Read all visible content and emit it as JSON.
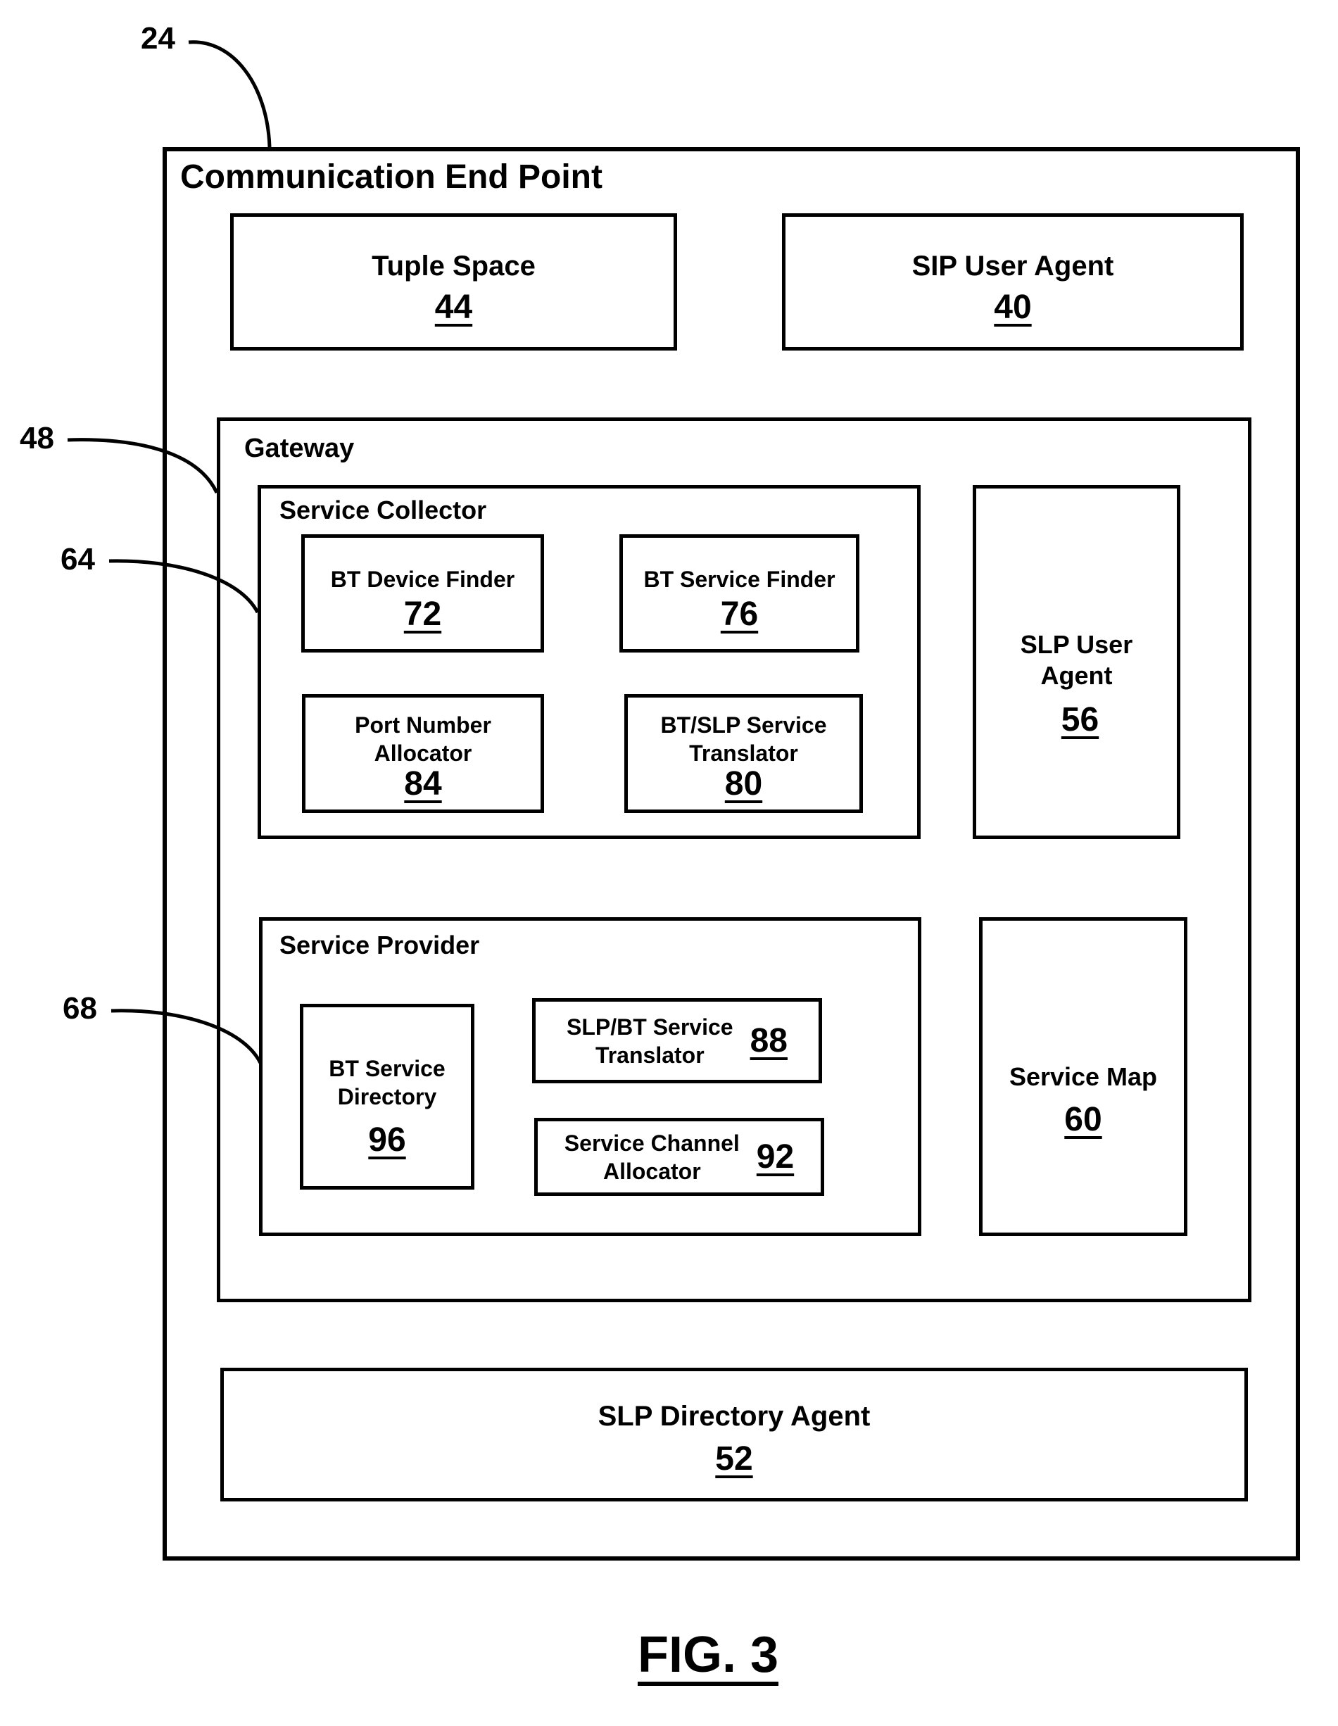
{
  "figure": {
    "caption": "FIG. 3",
    "callouts": {
      "endpoint": "24",
      "gateway": "48",
      "service_collector": "64",
      "service_provider": "68"
    }
  },
  "endpoint": {
    "title": "Communication End Point",
    "tuple_space": {
      "label": "Tuple Space",
      "ref": "44"
    },
    "sip_user_agent": {
      "label": "SIP User Agent",
      "ref": "40"
    },
    "slp_directory_agent": {
      "label": "SLP Directory Agent",
      "ref": "52"
    }
  },
  "gateway": {
    "title": "Gateway",
    "service_collector": {
      "title": "Service Collector",
      "bt_device_finder": {
        "label": "BT Device Finder",
        "ref": "72"
      },
      "bt_service_finder": {
        "label": "BT Service Finder",
        "ref": "76"
      },
      "port_number_allocator": {
        "line1": "Port Number",
        "line2": "Allocator",
        "ref": "84"
      },
      "bt_slp_translator": {
        "line1": "BT/SLP Service",
        "line2": "Translator",
        "ref": "80"
      }
    },
    "slp_user_agent": {
      "line1": "SLP User",
      "line2": "Agent",
      "ref": "56"
    },
    "service_provider": {
      "title": "Service Provider",
      "bt_service_directory": {
        "line1": "BT Service",
        "line2": "Directory",
        "ref": "96"
      },
      "slp_bt_translator": {
        "line1": "SLP/BT Service",
        "line2": "Translator",
        "ref": "88"
      },
      "service_channel_allocator": {
        "line1": "Service Channel",
        "line2": "Allocator",
        "ref": "92"
      }
    },
    "service_map": {
      "label": "Service Map",
      "ref": "60"
    }
  }
}
